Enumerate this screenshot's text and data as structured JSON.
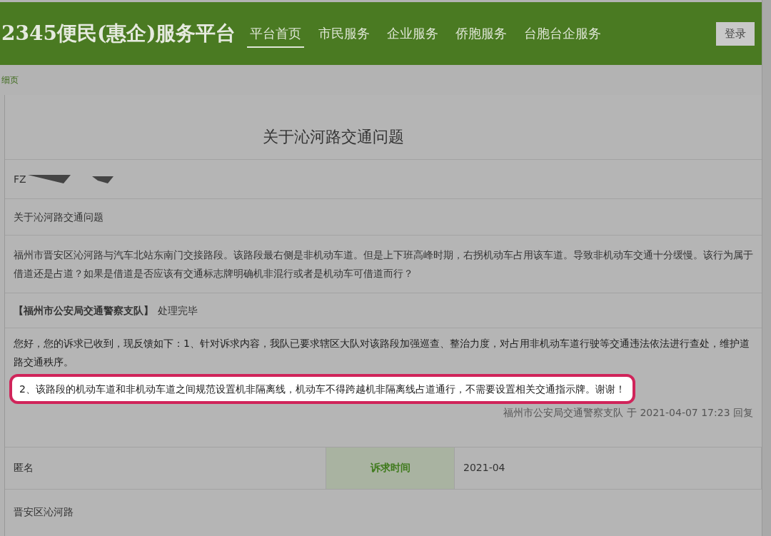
{
  "header": {
    "site_title": "2345便民(惠企)服务平台",
    "nav": [
      {
        "label": "平台首页",
        "selected": true
      },
      {
        "label": "市民服务",
        "selected": false
      },
      {
        "label": "企业服务",
        "selected": false
      },
      {
        "label": "侨胞服务",
        "selected": false
      },
      {
        "label": "台胞台企服务",
        "selected": false
      }
    ],
    "login": "登录"
  },
  "breadcrumb": "细页",
  "article": {
    "title": "关于沁河路交通问题",
    "id_prefix": "FZ",
    "subject": "关于沁河路交通问题",
    "content": "福州市晋安区沁河路与汽车北站东南门交接路段。该路段最右侧是非机动车道。但是上下班高峰时期，右拐机动车占用该车道。导致非机动车交通十分缓慢。该行为属于借道还是占道？如果是借道是否应该有交通标志牌明确机非混行或者是机动车可借道而行？",
    "handler": "【福州市公安局交通警察支队】",
    "handler_status": "处理完毕",
    "reply_lines": [
      {
        "text": "您好，您的诉求已收到，现反馈如下：1、针对诉求内容，我队已要求辖区大队对该路段加强巡查、整治力度，对占用非机动车道行驶等交通违法依法进行查处，维护道路交通秩序。",
        "highlighted": false
      },
      {
        "text": "2、该路段的机动车道和非机动车道之间规范设置机非隔离线，机动车不得跨越机非隔离线占道通行，不需要设置相关交通指示牌。谢谢！",
        "highlighted": true
      }
    ],
    "reply_signature": "福州市公安局交通警察支队 于 2021-04-07 17:23 回复",
    "author": "匿名",
    "time_label": "诉求时间",
    "time_value": "2021-04",
    "location": "晋安区沁河路"
  }
}
